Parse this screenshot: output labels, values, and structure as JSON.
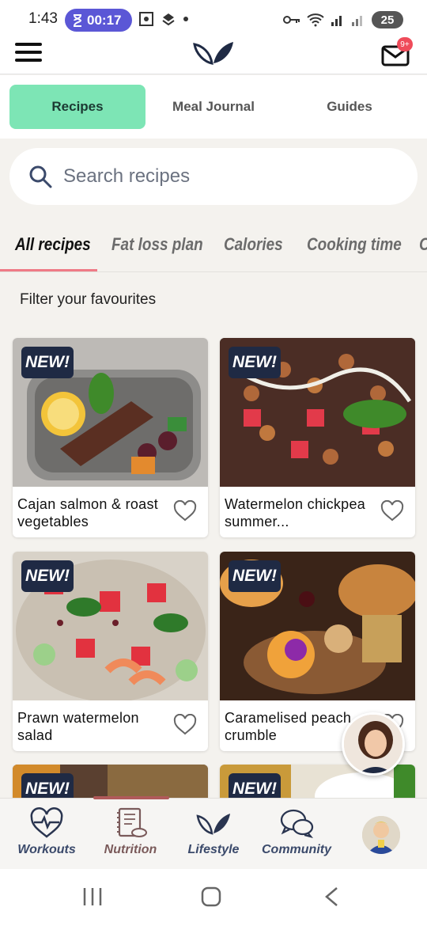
{
  "status_bar": {
    "time": "1:43",
    "timer": "00:17",
    "battery": "25"
  },
  "app_bar": {
    "mail_badge": "9+"
  },
  "segment_tabs": [
    {
      "label": "Recipes",
      "active": true
    },
    {
      "label": "Meal Journal",
      "active": false
    },
    {
      "label": "Guides",
      "active": false
    }
  ],
  "search": {
    "placeholder": "Search recipes"
  },
  "category_tabs": [
    {
      "label": "All recipes",
      "active": true
    },
    {
      "label": "Fat loss plan",
      "active": false
    },
    {
      "label": "Calories",
      "active": false
    },
    {
      "label": "Cooking time",
      "active": false
    },
    {
      "label": "C",
      "active": false
    }
  ],
  "filter_label": "Filter your favourites",
  "recipes": [
    {
      "badge": "NEW!",
      "title": "Cajan salmon & roast vegetables"
    },
    {
      "badge": "NEW!",
      "title": "Watermelon chickpea summer..."
    },
    {
      "badge": "NEW!",
      "title": "Prawn watermelon salad"
    },
    {
      "badge": "NEW!",
      "title": "Caramelised peach, crumble"
    },
    {
      "badge": "NEW!",
      "title": ""
    },
    {
      "badge": "NEW!",
      "title": ""
    }
  ],
  "bottom_nav": [
    {
      "label": "Workouts",
      "icon": "heart-pulse-icon"
    },
    {
      "label": "Nutrition",
      "icon": "recipe-book-icon"
    },
    {
      "label": "Lifestyle",
      "icon": "leaf-icon"
    },
    {
      "label": "Community",
      "icon": "chat-bubbles-icon"
    }
  ],
  "colors": {
    "accent": "#7de5b5",
    "badge_bg": "#1f2a44",
    "underline": "#ef7a86",
    "timer_bg": "#5b57d6"
  }
}
